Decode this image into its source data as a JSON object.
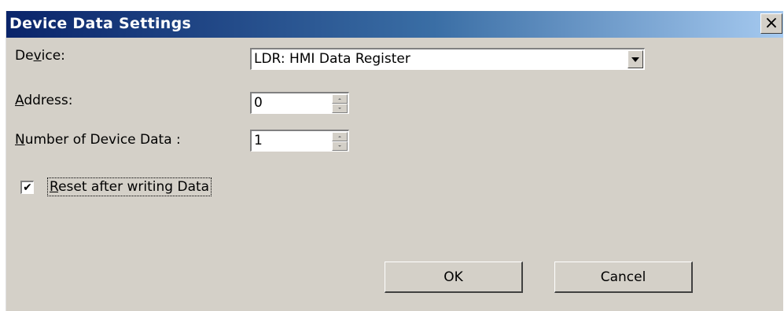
{
  "window": {
    "title": "Device Data Settings",
    "close_icon": "close-icon",
    "close_glyph": "×"
  },
  "fields": {
    "device": {
      "label_pre": "De",
      "label_key": "v",
      "label_post": "ice:",
      "value": "LDR: HMI Data Register"
    },
    "address": {
      "label_key": "A",
      "label_post": "ddress:",
      "value": "0"
    },
    "count": {
      "label_key": "N",
      "label_post": "umber of Device Data :",
      "value": "1"
    }
  },
  "reset": {
    "checked": true,
    "check_glyph": "✔",
    "label_key": "R",
    "label_post": "eset after writing Data"
  },
  "buttons": {
    "ok": "OK",
    "cancel": "Cancel"
  },
  "colors": {
    "dialog_bg": "#d4d0c8",
    "title_start": "#0a246a",
    "title_end": "#a6caf0"
  }
}
